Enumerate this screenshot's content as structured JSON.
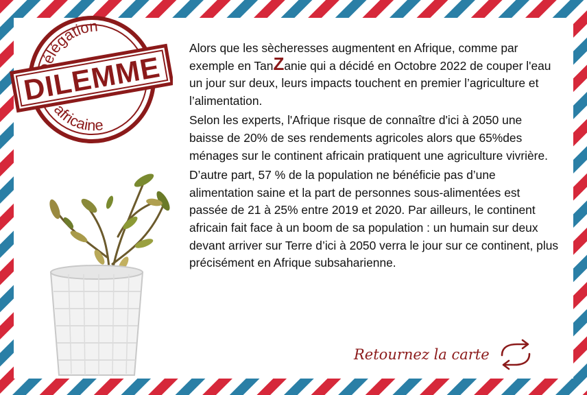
{
  "stamp": {
    "top_text": "Délégation",
    "main_text": "DILEMME",
    "bottom_text": "africaine",
    "color": "#8b1a1a"
  },
  "content": {
    "p1_before": "Alors que les sècheresses augmentent en Afrique, comme par exemple en Tan",
    "p1_z": "Z",
    "p1_after": "anie qui a décidé en Octobre 2022 de couper l'eau un jour sur deux, leurs impacts touchent en premier l’agriculture et l’alimentation.",
    "p2": "Selon les experts, l'Afrique risque de connaître d'ici à 2050 une baisse de 20% de ses rendements agricoles alors que 65%des ménages sur le continent africain pratiquent une agriculture vivrière.",
    "p3": "D’autre part, 57 % de la population ne bénéficie pas d’une alimentation saine et la part de personnes sous-alimentées est passée de 21 à 25% entre 2019 et 2020. Par ailleurs, le continent africain fait face à un boom de sa population : un humain sur deux devant arriver sur Terre d’ici à 2050 verra le jour sur ce continent, plus précisément en Afrique subsaharienne."
  },
  "footer": {
    "return_label": "Retournez la carte",
    "icon": "flip-arrows-icon"
  },
  "colors": {
    "airmail_red": "#d6283a",
    "airmail_blue": "#2a7fa6",
    "accent": "#8b1a1a"
  }
}
